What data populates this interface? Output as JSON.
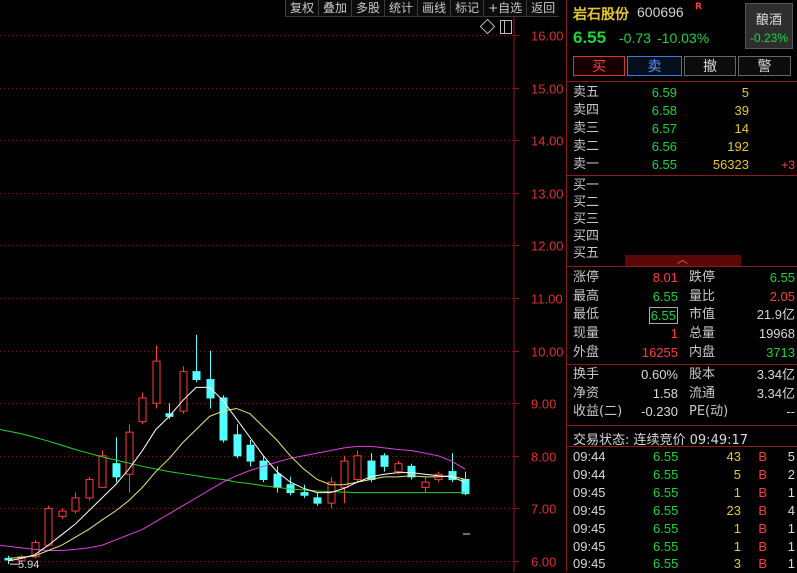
{
  "toolbar": [
    "复权",
    "叠加",
    "多股",
    "统计",
    "画线",
    "标记",
    "+自选",
    "返回"
  ],
  "chart_data": {
    "type": "candlestick",
    "y_ticks": [
      "16.00",
      "15.00",
      "14.00",
      "13.00",
      "12.00",
      "11.00",
      "10.00",
      "9.00",
      "8.00",
      "7.00",
      "6.00"
    ],
    "ylim": [
      5.8,
      16.3
    ],
    "low_marker": "5.94",
    "candles": [
      {
        "o": 6.05,
        "h": 6.1,
        "l": 5.94,
        "c": 6.02
      },
      {
        "o": 6.0,
        "h": 6.12,
        "l": 5.96,
        "c": 6.08
      },
      {
        "o": 6.08,
        "h": 6.4,
        "l": 6.05,
        "c": 6.35
      },
      {
        "o": 6.3,
        "h": 7.05,
        "l": 6.28,
        "c": 7.0
      },
      {
        "o": 6.85,
        "h": 7.0,
        "l": 6.8,
        "c": 6.95
      },
      {
        "o": 6.95,
        "h": 7.3,
        "l": 6.9,
        "c": 7.2
      },
      {
        "o": 7.2,
        "h": 7.6,
        "l": 7.15,
        "c": 7.55
      },
      {
        "o": 7.4,
        "h": 8.1,
        "l": 7.4,
        "c": 8.0
      },
      {
        "o": 7.85,
        "h": 8.35,
        "l": 7.5,
        "c": 7.6
      },
      {
        "o": 7.65,
        "h": 8.6,
        "l": 7.3,
        "c": 8.45
      },
      {
        "o": 8.65,
        "h": 9.2,
        "l": 8.6,
        "c": 9.1
      },
      {
        "o": 9.0,
        "h": 10.1,
        "l": 8.9,
        "c": 9.8
      },
      {
        "o": 8.8,
        "h": 9.0,
        "l": 8.7,
        "c": 8.75
      },
      {
        "o": 8.85,
        "h": 9.7,
        "l": 8.8,
        "c": 9.6
      },
      {
        "o": 9.6,
        "h": 10.3,
        "l": 9.4,
        "c": 9.45
      },
      {
        "o": 9.45,
        "h": 10.0,
        "l": 8.9,
        "c": 9.1
      },
      {
        "o": 9.1,
        "h": 9.15,
        "l": 8.25,
        "c": 8.3
      },
      {
        "o": 8.4,
        "h": 8.6,
        "l": 7.95,
        "c": 8.0
      },
      {
        "o": 8.2,
        "h": 8.3,
        "l": 7.8,
        "c": 7.9
      },
      {
        "o": 7.9,
        "h": 8.0,
        "l": 7.5,
        "c": 7.55
      },
      {
        "o": 7.65,
        "h": 7.8,
        "l": 7.3,
        "c": 7.4
      },
      {
        "o": 7.45,
        "h": 7.6,
        "l": 7.25,
        "c": 7.3
      },
      {
        "o": 7.3,
        "h": 7.45,
        "l": 7.2,
        "c": 7.25
      },
      {
        "o": 7.2,
        "h": 7.3,
        "l": 7.05,
        "c": 7.1
      },
      {
        "o": 7.1,
        "h": 7.6,
        "l": 7.0,
        "c": 7.5
      },
      {
        "o": 7.4,
        "h": 8.0,
        "l": 7.1,
        "c": 7.9
      },
      {
        "o": 7.55,
        "h": 8.1,
        "l": 7.5,
        "c": 8.0
      },
      {
        "o": 7.9,
        "h": 8.05,
        "l": 7.5,
        "c": 7.55
      },
      {
        "o": 8.0,
        "h": 8.05,
        "l": 7.7,
        "c": 7.8
      },
      {
        "o": 7.7,
        "h": 7.9,
        "l": 7.65,
        "c": 7.85
      },
      {
        "o": 7.8,
        "h": 7.85,
        "l": 7.55,
        "c": 7.6
      },
      {
        "o": 7.4,
        "h": 7.6,
        "l": 7.3,
        "c": 7.5
      },
      {
        "o": 7.55,
        "h": 7.7,
        "l": 7.5,
        "c": 7.65
      },
      {
        "o": 7.7,
        "h": 8.05,
        "l": 7.5,
        "c": 7.55
      },
      {
        "o": 7.55,
        "h": 7.7,
        "l": 7.25,
        "c": 7.28
      }
    ],
    "ma_white": [
      6.0,
      6.05,
      6.12,
      6.3,
      6.5,
      6.7,
      6.95,
      7.2,
      7.45,
      7.75,
      8.1,
      8.5,
      8.75,
      9.05,
      9.3,
      9.3,
      9.05,
      8.7,
      8.35,
      8.0,
      7.7,
      7.5,
      7.38,
      7.3,
      7.3,
      7.38,
      7.5,
      7.6,
      7.65,
      7.68,
      7.68,
      7.65,
      7.62,
      7.6,
      7.5
    ],
    "ma_yellow": [
      6.05,
      6.07,
      6.1,
      6.2,
      6.3,
      6.45,
      6.6,
      6.78,
      6.95,
      7.15,
      7.4,
      7.7,
      7.95,
      8.25,
      8.5,
      8.75,
      8.85,
      8.9,
      8.8,
      8.55,
      8.3,
      8.0,
      7.75,
      7.55,
      7.45,
      7.45,
      7.5,
      7.55,
      7.6,
      7.6,
      7.62,
      7.6,
      7.6,
      7.62,
      7.55
    ],
    "ma_magenta": [
      6.3,
      6.25,
      6.22,
      6.2,
      6.2,
      6.22,
      6.25,
      6.3,
      6.4,
      6.5,
      6.6,
      6.75,
      6.9,
      7.05,
      7.2,
      7.35,
      7.5,
      7.62,
      7.72,
      7.8,
      7.88,
      7.95,
      8.0,
      8.05,
      8.1,
      8.15,
      8.18,
      8.18,
      8.15,
      8.12,
      8.1,
      8.05,
      8.0,
      7.9,
      7.75
    ],
    "ma_green": [
      8.5,
      8.42,
      8.35,
      8.28,
      8.2,
      8.12,
      8.05,
      7.98,
      7.92,
      7.86,
      7.8,
      7.75,
      7.7,
      7.66,
      7.62,
      7.58,
      7.55,
      7.5,
      7.47,
      7.43,
      7.4,
      7.37,
      7.35,
      7.33,
      7.32,
      7.31,
      7.3,
      7.3,
      7.3,
      7.3,
      7.3,
      7.3,
      7.3,
      7.3,
      7.3
    ]
  },
  "header": {
    "name": "岩石股份",
    "code": "600696",
    "flag": "R",
    "price": "6.55",
    "change": "-0.73",
    "change_pct": "-10.03%",
    "sector": "酿酒",
    "sector_pct": "-0.23%"
  },
  "buttons": {
    "buy": "买",
    "sell": "卖",
    "cancel": "撤",
    "warn": "警"
  },
  "asks": [
    {
      "label": "卖五",
      "price": "6.59",
      "vol": "5",
      "delta": ""
    },
    {
      "label": "卖四",
      "price": "6.58",
      "vol": "39",
      "delta": ""
    },
    {
      "label": "卖三",
      "price": "6.57",
      "vol": "14",
      "delta": ""
    },
    {
      "label": "卖二",
      "price": "6.56",
      "vol": "192",
      "delta": ""
    },
    {
      "label": "卖一",
      "price": "6.55",
      "vol": "56323",
      "delta": "+3"
    }
  ],
  "bids": [
    {
      "label": "买一"
    },
    {
      "label": "买二"
    },
    {
      "label": "买三"
    },
    {
      "label": "买四"
    },
    {
      "label": "买五"
    }
  ],
  "stats": [
    {
      "l1": "涨停",
      "v1": "8.01",
      "l2": "跌停",
      "v2": "6.55"
    },
    {
      "l1": "最高",
      "v1": "6.55",
      "l2": "量比",
      "v2": "2.05"
    },
    {
      "l1": "最低",
      "v1": "6.55",
      "l2": "市值",
      "v2": "21.9亿"
    },
    {
      "l1": "现量",
      "v1": "1",
      "l2": "总量",
      "v2": "19968"
    },
    {
      "l1": "外盘",
      "v1": "16255",
      "l2": "内盘",
      "v2": "3713"
    }
  ],
  "stats2": [
    {
      "l1": "换手",
      "v1": "0.60%",
      "l2": "股本",
      "v2": "3.34亿"
    },
    {
      "l1": "净资",
      "v1": "1.58",
      "l2": "流通",
      "v2": "3.34亿"
    },
    {
      "l1": "收益(二)",
      "v1": "-0.230",
      "l2": "PE(动)",
      "v2": "--"
    }
  ],
  "trade_status": "交易状态: 连续竞价 09:49:17",
  "ticks": [
    {
      "time": "09:44",
      "price": "6.55",
      "vol": "43",
      "dir": "B",
      "cnt": "5"
    },
    {
      "time": "09:44",
      "price": "6.55",
      "vol": "5",
      "dir": "B",
      "cnt": "2"
    },
    {
      "time": "09:45",
      "price": "6.55",
      "vol": "1",
      "dir": "B",
      "cnt": "1"
    },
    {
      "time": "09:45",
      "price": "6.55",
      "vol": "23",
      "dir": "B",
      "cnt": "4"
    },
    {
      "time": "09:45",
      "price": "6.55",
      "vol": "1",
      "dir": "B",
      "cnt": "1"
    },
    {
      "time": "09:45",
      "price": "6.55",
      "vol": "1",
      "dir": "B",
      "cnt": "1"
    },
    {
      "time": "09:45",
      "price": "6.55",
      "vol": "3",
      "dir": "B",
      "cnt": "1"
    }
  ]
}
